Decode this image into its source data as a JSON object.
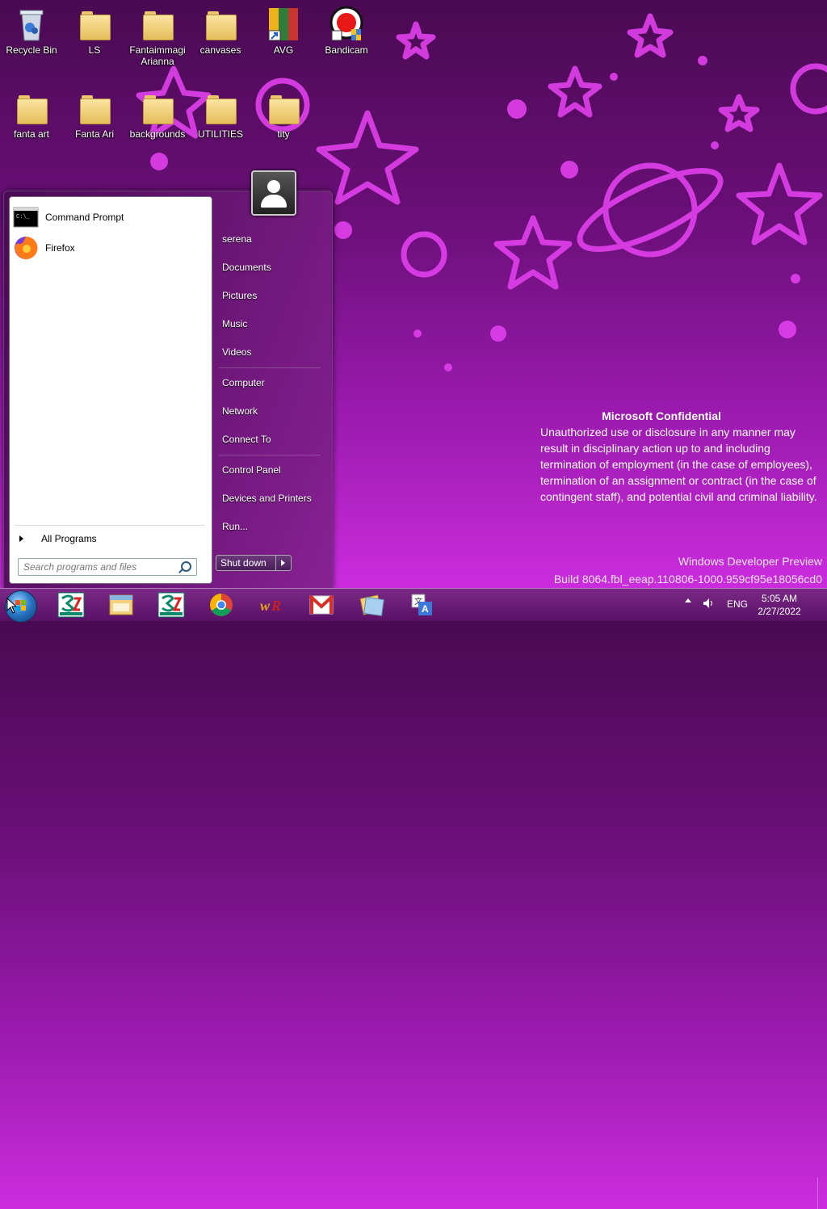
{
  "desktop": {
    "icons": [
      {
        "label": "Recycle Bin",
        "icon": "recycle-bin-icon"
      },
      {
        "label": "LS",
        "icon": "folder-icon"
      },
      {
        "label": "Fantaimmagi Arianna",
        "icon": "folder-icon"
      },
      {
        "label": "canvases",
        "icon": "folder-icon"
      },
      {
        "label": "AVG",
        "icon": "avg-icon"
      },
      {
        "label": "Bandicam",
        "icon": "bandicam-icon"
      },
      {
        "label": "fanta art",
        "icon": "folder-icon"
      },
      {
        "label": "Fanta Ari",
        "icon": "folder-icon"
      },
      {
        "label": "backgrounds",
        "icon": "folder-icon"
      },
      {
        "label": "UTILITIES",
        "icon": "folder-icon"
      },
      {
        "label": "tity",
        "icon": "folder-icon"
      }
    ],
    "watermark": {
      "title": "Microsoft Confidential",
      "body": "Unauthorized use or disclosure in any manner may result in disciplinary action up to and including termination of employment (in the case of employees), termination of an assignment or contract (in the case of contingent staff), and potential civil and criminal liability.",
      "product": "Windows Developer Preview",
      "build": "Build 8064.fbl_eeap.110806-1000.959cf95e18056cd0"
    }
  },
  "start_menu": {
    "pinned": [
      {
        "label": "Command Prompt",
        "icon": "command-prompt-icon"
      },
      {
        "label": "Firefox",
        "icon": "firefox-icon"
      }
    ],
    "all_programs": "All Programs",
    "search_placeholder": "Search programs and files",
    "right": {
      "user": "serena",
      "items": [
        "Documents",
        "Pictures",
        "Music",
        "Videos",
        "Computer",
        "Network",
        "Connect To",
        "Control Panel",
        "Devices and Printers",
        "Run..."
      ]
    },
    "shutdown": "Shut down"
  },
  "taskbar": {
    "apps": [
      "credit-agricole-icon",
      "file-explorer-icon",
      "credit-agricole-icon",
      "chrome-icon",
      "wr-icon",
      "gmail-icon",
      "folders-icon",
      "translate-icon"
    ],
    "language": "ENG",
    "time": "5:05 AM",
    "date": "2/27/2022"
  },
  "colors": {
    "wallpaper_top": "#4a0a52",
    "wallpaper_bottom": "#d430e6",
    "decoration": "#e040ec"
  }
}
